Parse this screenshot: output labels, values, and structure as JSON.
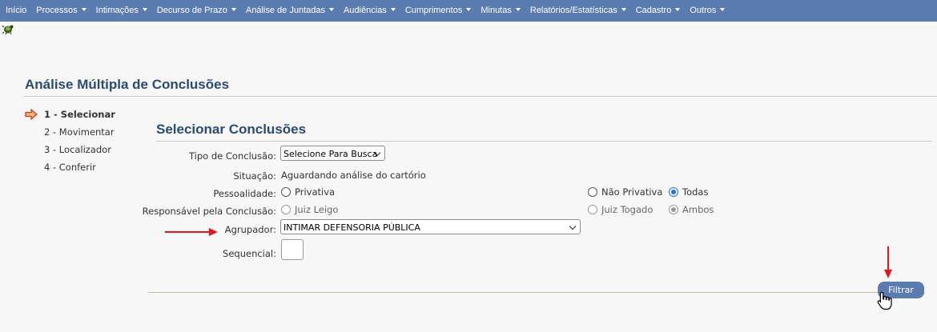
{
  "nav": {
    "items": [
      {
        "label": "Início",
        "dropdown": false
      },
      {
        "label": "Processos",
        "dropdown": true
      },
      {
        "label": "Intimações",
        "dropdown": true
      },
      {
        "label": "Decurso de Prazo",
        "dropdown": true
      },
      {
        "label": "Análise de Juntadas",
        "dropdown": true
      },
      {
        "label": "Audiências",
        "dropdown": true
      },
      {
        "label": "Cumprimentos",
        "dropdown": true
      },
      {
        "label": "Minutas",
        "dropdown": true
      },
      {
        "label": "Relatórios/Estatísticas",
        "dropdown": true
      },
      {
        "label": "Cadastro",
        "dropdown": true
      },
      {
        "label": "Outros",
        "dropdown": true
      }
    ]
  },
  "page": {
    "title": "Análise Múltipla de Conclusões"
  },
  "steps": [
    {
      "label": "1 - Selecionar",
      "active": true
    },
    {
      "label": "2 - Movimentar",
      "active": false
    },
    {
      "label": "3 - Localizador",
      "active": false
    },
    {
      "label": "4 - Conferir",
      "active": false
    }
  ],
  "form": {
    "section_title": "Selecionar Conclusões",
    "tipo_label": "Tipo de Conclusão:",
    "tipo_value": "Selecione Para Busca",
    "situacao_label": "Situação:",
    "situacao_value": "Aguardando análise do cartório",
    "pessoalidade_label": "Pessoalidade:",
    "pessoalidade_options": [
      "Privativa",
      "Não Privativa",
      "Todas"
    ],
    "pessoalidade_selected": "Todas",
    "responsavel_label": "Responsável pela Conclusão:",
    "responsavel_options": [
      "Juiz Leigo",
      "Juiz Togado",
      "Ambos"
    ],
    "responsavel_selected": "Ambos",
    "agrupador_label": "Agrupador:",
    "agrupador_value": "INTIMAR DEFENSORIA PÚBLICA",
    "sequencial_label": "Sequencial:",
    "sequencial_value": "",
    "filter_label": "Filtrar"
  },
  "colors": {
    "nav_bg": "#5b7cae",
    "title": "#2c4a72",
    "annotation_arrow": "#e8141b"
  }
}
